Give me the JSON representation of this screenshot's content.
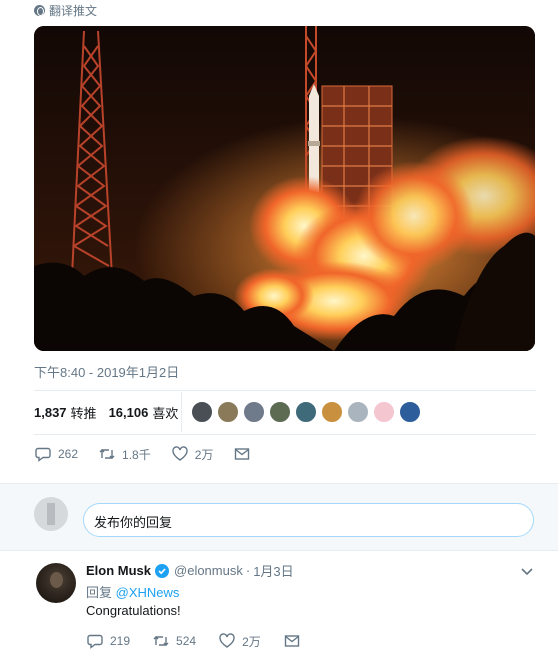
{
  "translate": {
    "label": "翻译推文",
    "icon": "globe-icon"
  },
  "tweet": {
    "timestamp": "下午8:40 - 2019年1月2日",
    "stats": {
      "retweets_count": "1,837",
      "retweets_label": "转推",
      "likes_count": "16,106",
      "likes_label": "喜欢"
    },
    "liker_avatars": [
      "#4a4f55",
      "#8a7a5a",
      "#6f7a8a",
      "#5c6b52",
      "#3f6a7a",
      "#c9903f",
      "#aab4be",
      "#f4c6cf",
      "#2e5d9c"
    ],
    "actions": {
      "reply_count": "262",
      "retweet_count": "1.8千",
      "like_count": "2万"
    }
  },
  "composer": {
    "placeholder": "发布你的回复"
  },
  "reply": {
    "name": "Elon Musk",
    "handle": "@elonmusk",
    "separator": "·",
    "date": "1月3日",
    "replying_prefix": "回复",
    "replying_to": "@XHNews",
    "text": "Congratulations!",
    "actions": {
      "reply_count": "219",
      "retweet_count": "524",
      "like_count": "2万"
    }
  },
  "colors": {
    "accent": "#1da1f2",
    "muted": "#657786",
    "text": "#14171a"
  }
}
